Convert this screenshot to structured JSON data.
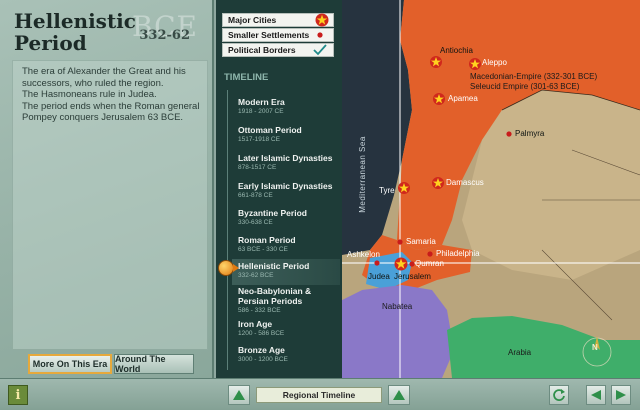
{
  "era": {
    "title": "Hellenistic Period",
    "watermark": "BCE",
    "range": "332-62",
    "description": "The era of Alexander the Great and his successors, who ruled the region.\nThe Hasmoneans rule in Judea.\nThe period ends when the Roman general Pompey conquers Jerusalem 63 BCE."
  },
  "buttons": {
    "more": "More On This Era",
    "world": "Around The World"
  },
  "legend": [
    {
      "label": "Major Cities",
      "icon": "star-icon"
    },
    {
      "label": "Smaller Settlements",
      "icon": "dot-icon"
    },
    {
      "label": "Political Borders",
      "icon": "checkmark-icon"
    }
  ],
  "timeline": {
    "heading": "TIMELINE",
    "items": [
      {
        "name": "Modern Era",
        "range": "1918 - 2007 CE"
      },
      {
        "name": "Ottoman Period",
        "range": "1517-1918 CE"
      },
      {
        "name": "Later Islamic Dynasties",
        "range": "878-1517 CE"
      },
      {
        "name": "Early Islamic Dynasties",
        "range": "661-878 CE"
      },
      {
        "name": "Byzantine Period",
        "range": "330-638 CE"
      },
      {
        "name": "Roman Period",
        "range": "63 BCE - 330 CE"
      },
      {
        "name": "Hellenistic Period",
        "range": "332-62 BCE"
      },
      {
        "name": "Neo-Babylonian & Persian Periods",
        "range": "586 - 332 BCE"
      },
      {
        "name": "Iron Age",
        "range": "1200 - 586 BCE"
      },
      {
        "name": "Bronze Age",
        "range": "3000 - 1200 BCE"
      }
    ],
    "active_index": 6
  },
  "map": {
    "sea": "Mediterranean Sea",
    "empire_note": "Macedonian-Empire (332-301 BCE)\nSeleucid Empire (301-63 BCE)",
    "cities": [
      {
        "name": "Antiochia",
        "kind": "major"
      },
      {
        "name": "Aleppo",
        "kind": "major"
      },
      {
        "name": "Apamea",
        "kind": "major"
      },
      {
        "name": "Palmyra",
        "kind": "settlement"
      },
      {
        "name": "Tyre",
        "kind": "major"
      },
      {
        "name": "Damascus",
        "kind": "major"
      },
      {
        "name": "Samaria",
        "kind": "settlement"
      },
      {
        "name": "Ashkelon",
        "kind": "settlement"
      },
      {
        "name": "Philadelphia",
        "kind": "settlement"
      },
      {
        "name": "Judea",
        "kind": "region"
      },
      {
        "name": "Jerusalem",
        "kind": "major"
      },
      {
        "name": "Qumran",
        "kind": "settlement"
      },
      {
        "name": "Nabatea",
        "kind": "region"
      },
      {
        "name": "Arabia",
        "kind": "region"
      }
    ],
    "compass": "N"
  },
  "bottom": {
    "info": "i",
    "regional": "Regional Timeline"
  },
  "colors": {
    "seleucid": "#e2602a",
    "ptolemaic": "#8a78c8",
    "nabatea_green": "#3fae6a",
    "judea_blue": "#4aa0d8",
    "accent": "#e6a93c"
  }
}
